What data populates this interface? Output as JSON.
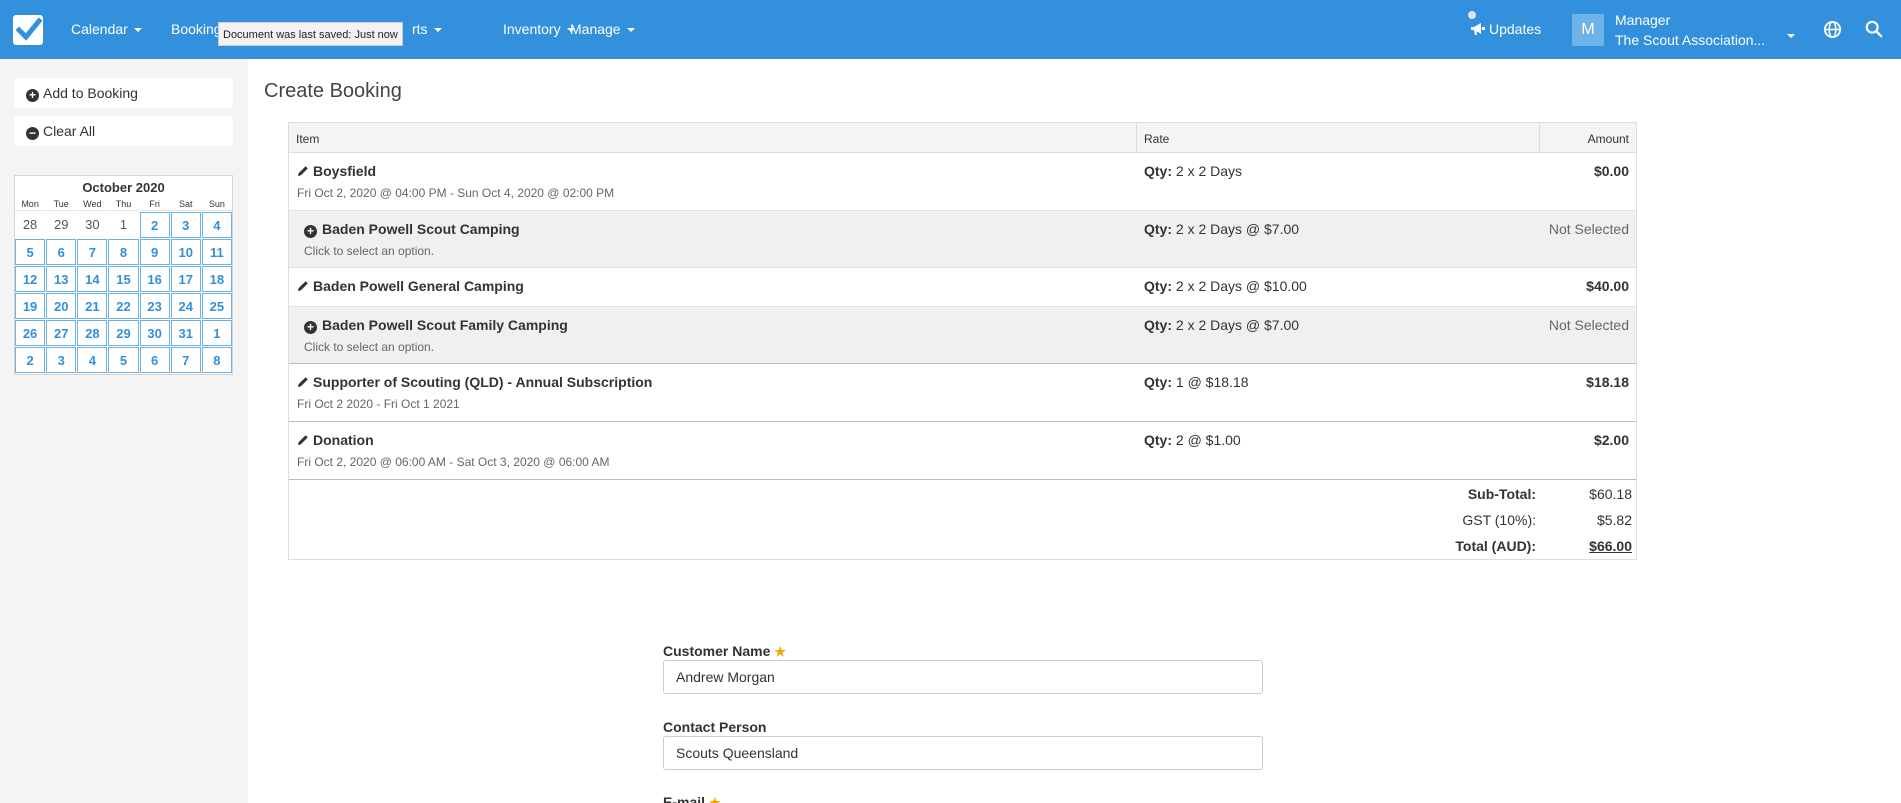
{
  "nav": {
    "items": [
      {
        "label": "Calendar"
      },
      {
        "label": "Booking"
      },
      {
        "label": "rts"
      },
      {
        "label": "Inventory"
      },
      {
        "label": "Manage"
      }
    ],
    "tooltip": "Document was last saved: Just now",
    "updates_label": "Updates",
    "user": {
      "initial": "M",
      "role": "Manager",
      "org": "The Scout Association..."
    }
  },
  "sidebar": {
    "add_label": "Add to Booking",
    "clear_label": "Clear All",
    "calendar": {
      "title": "October 2020",
      "weekdays": [
        "Mon",
        "Tue",
        "Wed",
        "Thu",
        "Fri",
        "Sat",
        "Sun"
      ],
      "weeks": [
        [
          "28",
          "29",
          "30",
          "1",
          "2",
          "3",
          "4"
        ],
        [
          "5",
          "6",
          "7",
          "8",
          "9",
          "10",
          "11"
        ],
        [
          "12",
          "13",
          "14",
          "15",
          "16",
          "17",
          "18"
        ],
        [
          "19",
          "20",
          "21",
          "22",
          "23",
          "24",
          "25"
        ],
        [
          "26",
          "27",
          "28",
          "29",
          "30",
          "31",
          "1"
        ],
        [
          "2",
          "3",
          "4",
          "5",
          "6",
          "7",
          "8"
        ]
      ]
    }
  },
  "main": {
    "title": "Create Booking",
    "table": {
      "headers": {
        "item": "Item",
        "rate": "Rate",
        "amount": "Amount"
      },
      "qty_label": "Qty:",
      "rows": [
        {
          "name": "Boysfield",
          "detail": "Fri Oct 2, 2020 @ 04:00 PM - Sun Oct 4, 2020 @ 02:00 PM",
          "qty": "2 x 2 Days",
          "amount": "$0.00"
        },
        {
          "name": "Baden Powell Scout Camping",
          "detail": "Click to select an option.",
          "qty": "2 x 2 Days @ $7.00",
          "amount": "Not Selected"
        },
        {
          "name": "Baden Powell General Camping",
          "qty": "2 x 2 Days @ $10.00",
          "amount": "$40.00"
        },
        {
          "name": "Baden Powell Scout Family Camping",
          "detail": "Click to select an option.",
          "qty": "2 x 2 Days @ $7.00",
          "amount": "Not Selected"
        },
        {
          "name": "Supporter of Scouting (QLD) - Annual Subscription",
          "detail": "Fri Oct 2 2020 - Fri Oct 1 2021",
          "qty": "1 @ $18.18",
          "amount": "$18.18"
        },
        {
          "name": "Donation",
          "detail": "Fri Oct 2, 2020 @ 06:00 AM - Sat Oct 3, 2020 @ 06:00 AM",
          "qty": "2 @ $1.00",
          "amount": "$2.00"
        }
      ],
      "totals": {
        "subtotal_label": "Sub-Total:",
        "subtotal": "$60.18",
        "gst_label": "GST (10%):",
        "gst": "$5.82",
        "total_label": "Total (AUD):",
        "total": "$66.00"
      }
    },
    "form": {
      "customer_label": "Customer Name",
      "customer_value": "Andrew Morgan",
      "contact_label": "Contact Person",
      "contact_value": "Scouts Queensland",
      "email_label": "E-mail",
      "required_mark": "★"
    }
  }
}
